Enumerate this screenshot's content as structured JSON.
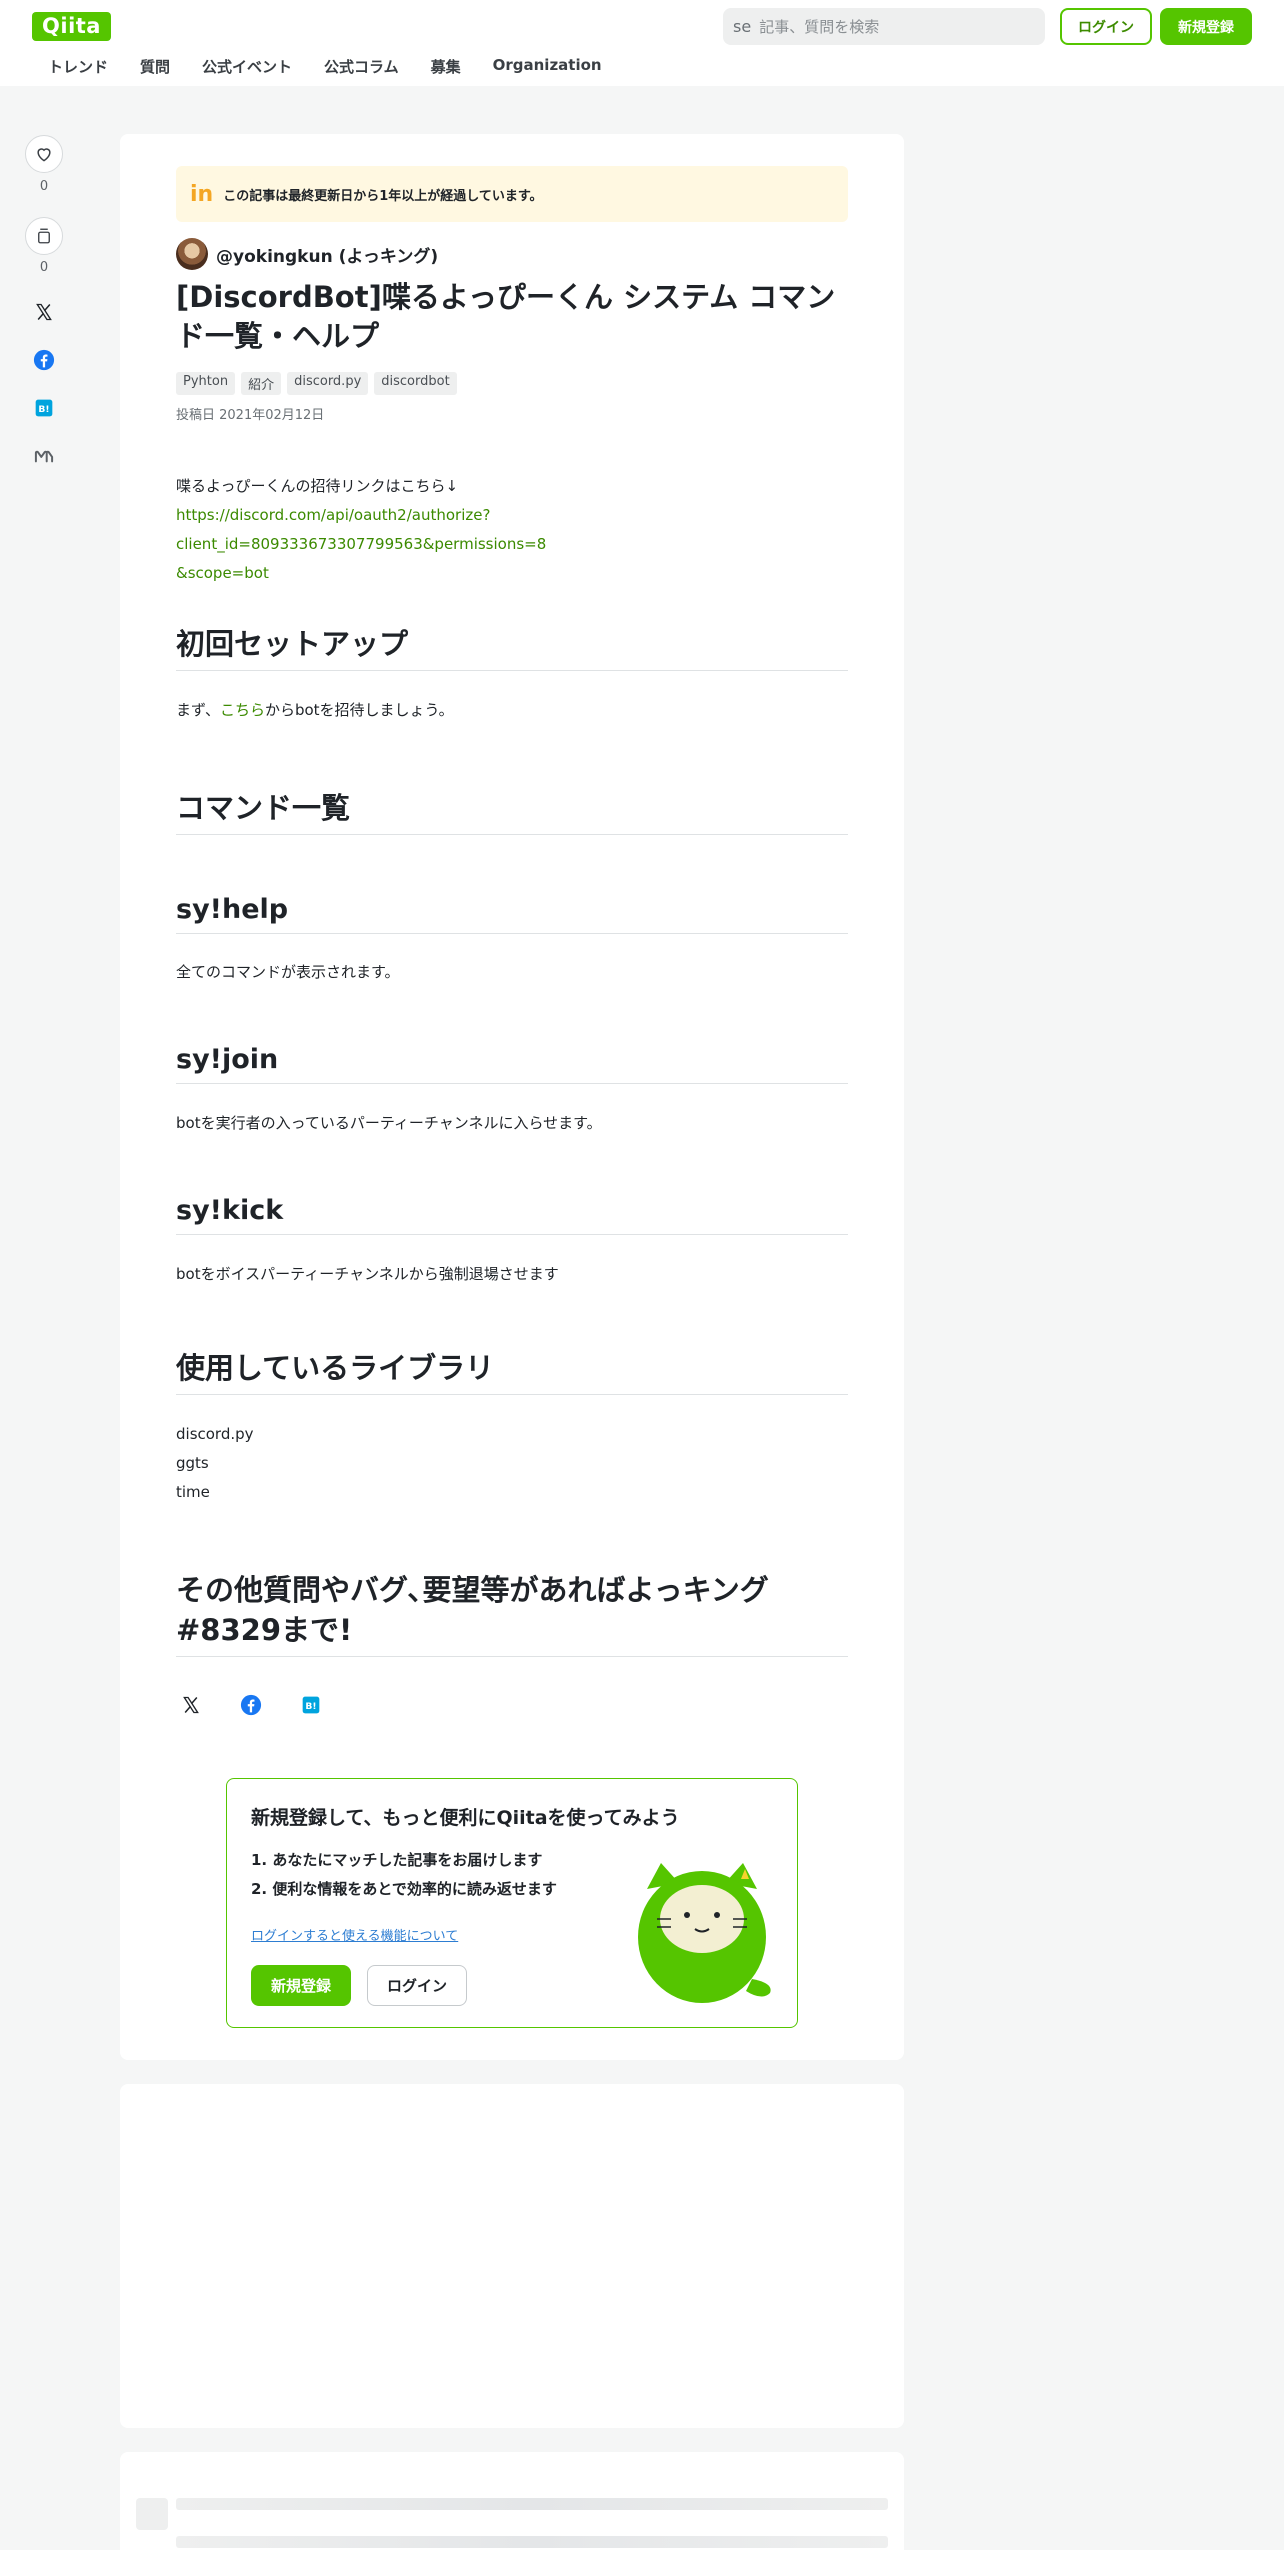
{
  "header": {
    "logo": "Qiita",
    "search_icon_text": "se",
    "search_placeholder": "記事、質問を検索",
    "login": "ログイン",
    "signup": "新規登録",
    "nav": [
      "トレンド",
      "質問",
      "公式イベント",
      "公式コラム",
      "募集",
      "Organization"
    ]
  },
  "sidebar": {
    "like_count": "0",
    "stock_count": "0"
  },
  "article": {
    "notice": "この記事は最終更新日から1年以上が経過しています。",
    "author": "@yokingkun (よっキング)",
    "title": "[DiscordBot]喋るよっぴーくん システム コマンド一覧・ヘルプ",
    "tags": [
      "Pyhton",
      "紹介",
      "discord.py",
      "discordbot"
    ],
    "posted": "投稿日 2021年02月12日",
    "intro": "喋るよっぴーくんの招待リンクはこちら↓",
    "invite_link_1": "https://discord.com/api/oauth2/authorize?client_id=809333673307799563&permissions=8",
    "invite_link_2": "&scope=bot",
    "h_setup": "初回セットアップ",
    "setup_pre": "まず、",
    "setup_link": "こちら",
    "setup_post": "からbotを招待しましょう。",
    "h_commands": "コマンド一覧",
    "h_help": "sy!help",
    "help_desc": "全てのコマンドが表示されます。",
    "h_join": "sy!join",
    "join_desc": "botを実行者の入っているパーティーチャンネルに入らせます。",
    "h_kick": "sy!kick",
    "kick_desc": "botをボイスパーティーチャンネルから強制退場させます",
    "h_libs": "使用しているライブラリ",
    "libs": [
      "discord.py",
      "ggts",
      "time"
    ],
    "h_contact": "その他質問やバグ､要望等があればよっキング#8329まで!"
  },
  "signup_box": {
    "title": "新規登録して、もっと便利にQiitaを使ってみよう",
    "point1": "1. あなたにマッチした記事をお届けします",
    "point2": "2. 便利な情報をあとで効率的に読み返せます",
    "link": "ログインすると使える機能について",
    "signup": "新規登録",
    "login": "ログイン"
  },
  "colors": {
    "brand": "#55c500",
    "link": "#3b8a00",
    "notice_bg": "#fff8e1"
  }
}
